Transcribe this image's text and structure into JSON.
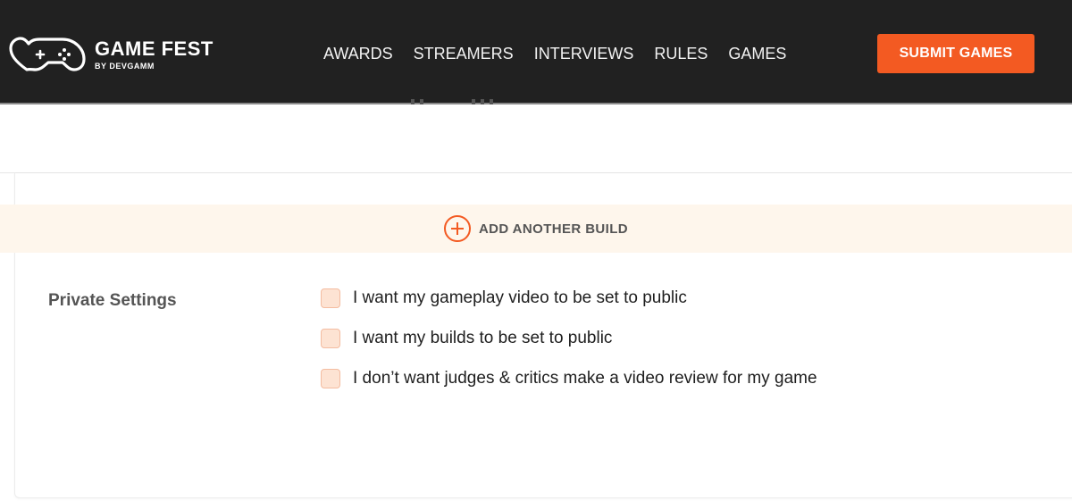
{
  "brand": {
    "title": "GAME FEST",
    "subtitle": "BY DEVGAMM",
    "accent_color": "#f35a22"
  },
  "nav": {
    "items": [
      {
        "label": "AWARDS"
      },
      {
        "label": "STREAMERS"
      },
      {
        "label": "INTERVIEWS"
      },
      {
        "label": "RULES"
      },
      {
        "label": "GAMES"
      }
    ]
  },
  "header": {
    "submit_label": "SUBMIT GAMES"
  },
  "builds": {
    "add_label": "ADD ANOTHER BUILD"
  },
  "private_settings": {
    "label": "Private Settings",
    "options": [
      {
        "label": "I want my gameplay video to be set to public",
        "checked": false
      },
      {
        "label": "I want my builds to be set to public",
        "checked": false
      },
      {
        "label": "I don’t want judges & critics make a video review for my game",
        "checked": false
      }
    ]
  }
}
